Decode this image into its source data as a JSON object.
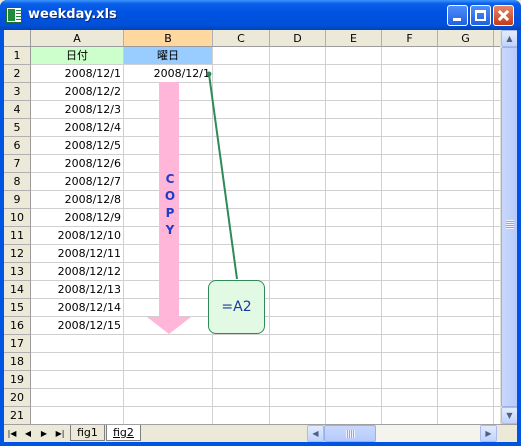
{
  "window": {
    "title": "weekday.xls"
  },
  "columns": [
    "A",
    "B",
    "C",
    "D",
    "E",
    "F",
    "G"
  ],
  "rows": [
    "1",
    "2",
    "3",
    "4",
    "5",
    "6",
    "7",
    "8",
    "9",
    "10",
    "11",
    "12",
    "13",
    "14",
    "15",
    "16",
    "17",
    "18",
    "19",
    "20",
    "21"
  ],
  "header_cells": {
    "a1": "日付",
    "b1": "曜日"
  },
  "dates": [
    "2008/12/1",
    "2008/12/2",
    "2008/12/3",
    "2008/12/4",
    "2008/12/5",
    "2008/12/6",
    "2008/12/7",
    "2008/12/8",
    "2008/12/9",
    "2008/12/10",
    "2008/12/11",
    "2008/12/12",
    "2008/12/13",
    "2008/12/14",
    "2008/12/15"
  ],
  "b2_value": "2008/12/1",
  "annotation": {
    "copy_letters": [
      "C",
      "O",
      "P",
      "Y"
    ],
    "formula": "=A2"
  },
  "sheet_tabs": [
    "fig1",
    "fig2"
  ],
  "active_tab": "fig2",
  "nav_buttons": [
    "|◀",
    "◀",
    "▶",
    "▶|"
  ],
  "colors": {
    "header_a_fill": "#ccffcc",
    "header_b_fill": "#99ccff",
    "arrow": "#ffb6d9",
    "connector": "#2e8b57",
    "callout_fill": "#e2fae4",
    "title_bar": "#0054e3"
  }
}
